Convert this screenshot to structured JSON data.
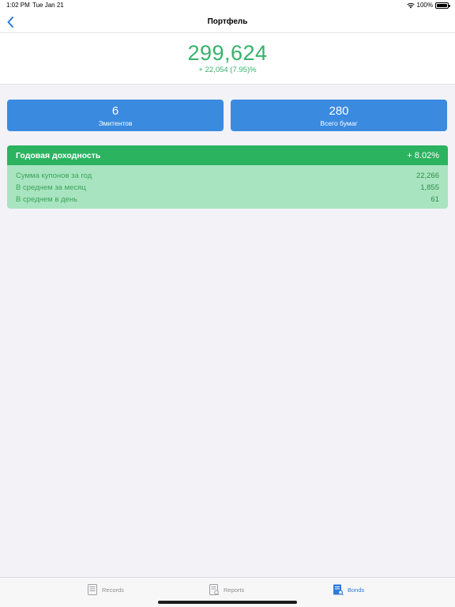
{
  "status_bar": {
    "time": "1:02 PM",
    "date": "Tue Jan 21",
    "battery": "100%"
  },
  "nav": {
    "title": "Портфель"
  },
  "portfolio": {
    "total": "299,624",
    "change": "+ 22,054 (7.95)%"
  },
  "stats": {
    "issuers": {
      "value": "6",
      "label": "Эмитентов"
    },
    "securities": {
      "value": "280",
      "label": "Всего бумаг"
    }
  },
  "yield": {
    "title": "Годовая доходность",
    "value": "+ 8.02%",
    "rows": [
      {
        "label": "Сумма купонов за год",
        "value": "22,266"
      },
      {
        "label": "В среднем за месяц",
        "value": "1,855"
      },
      {
        "label": "В среднем в день",
        "value": "61"
      }
    ]
  },
  "tabs": [
    {
      "label": "Records",
      "icon": "records-icon",
      "active": false
    },
    {
      "label": "Reports",
      "icon": "reports-icon",
      "active": false
    },
    {
      "label": "Bonds",
      "icon": "bonds-icon",
      "active": true
    }
  ],
  "colors": {
    "accent_green": "#34b36b",
    "card_blue": "#3a8ae0",
    "yield_header": "#2bb360",
    "yield_body": "#a9e4c0",
    "tab_active": "#2f7bd8"
  }
}
